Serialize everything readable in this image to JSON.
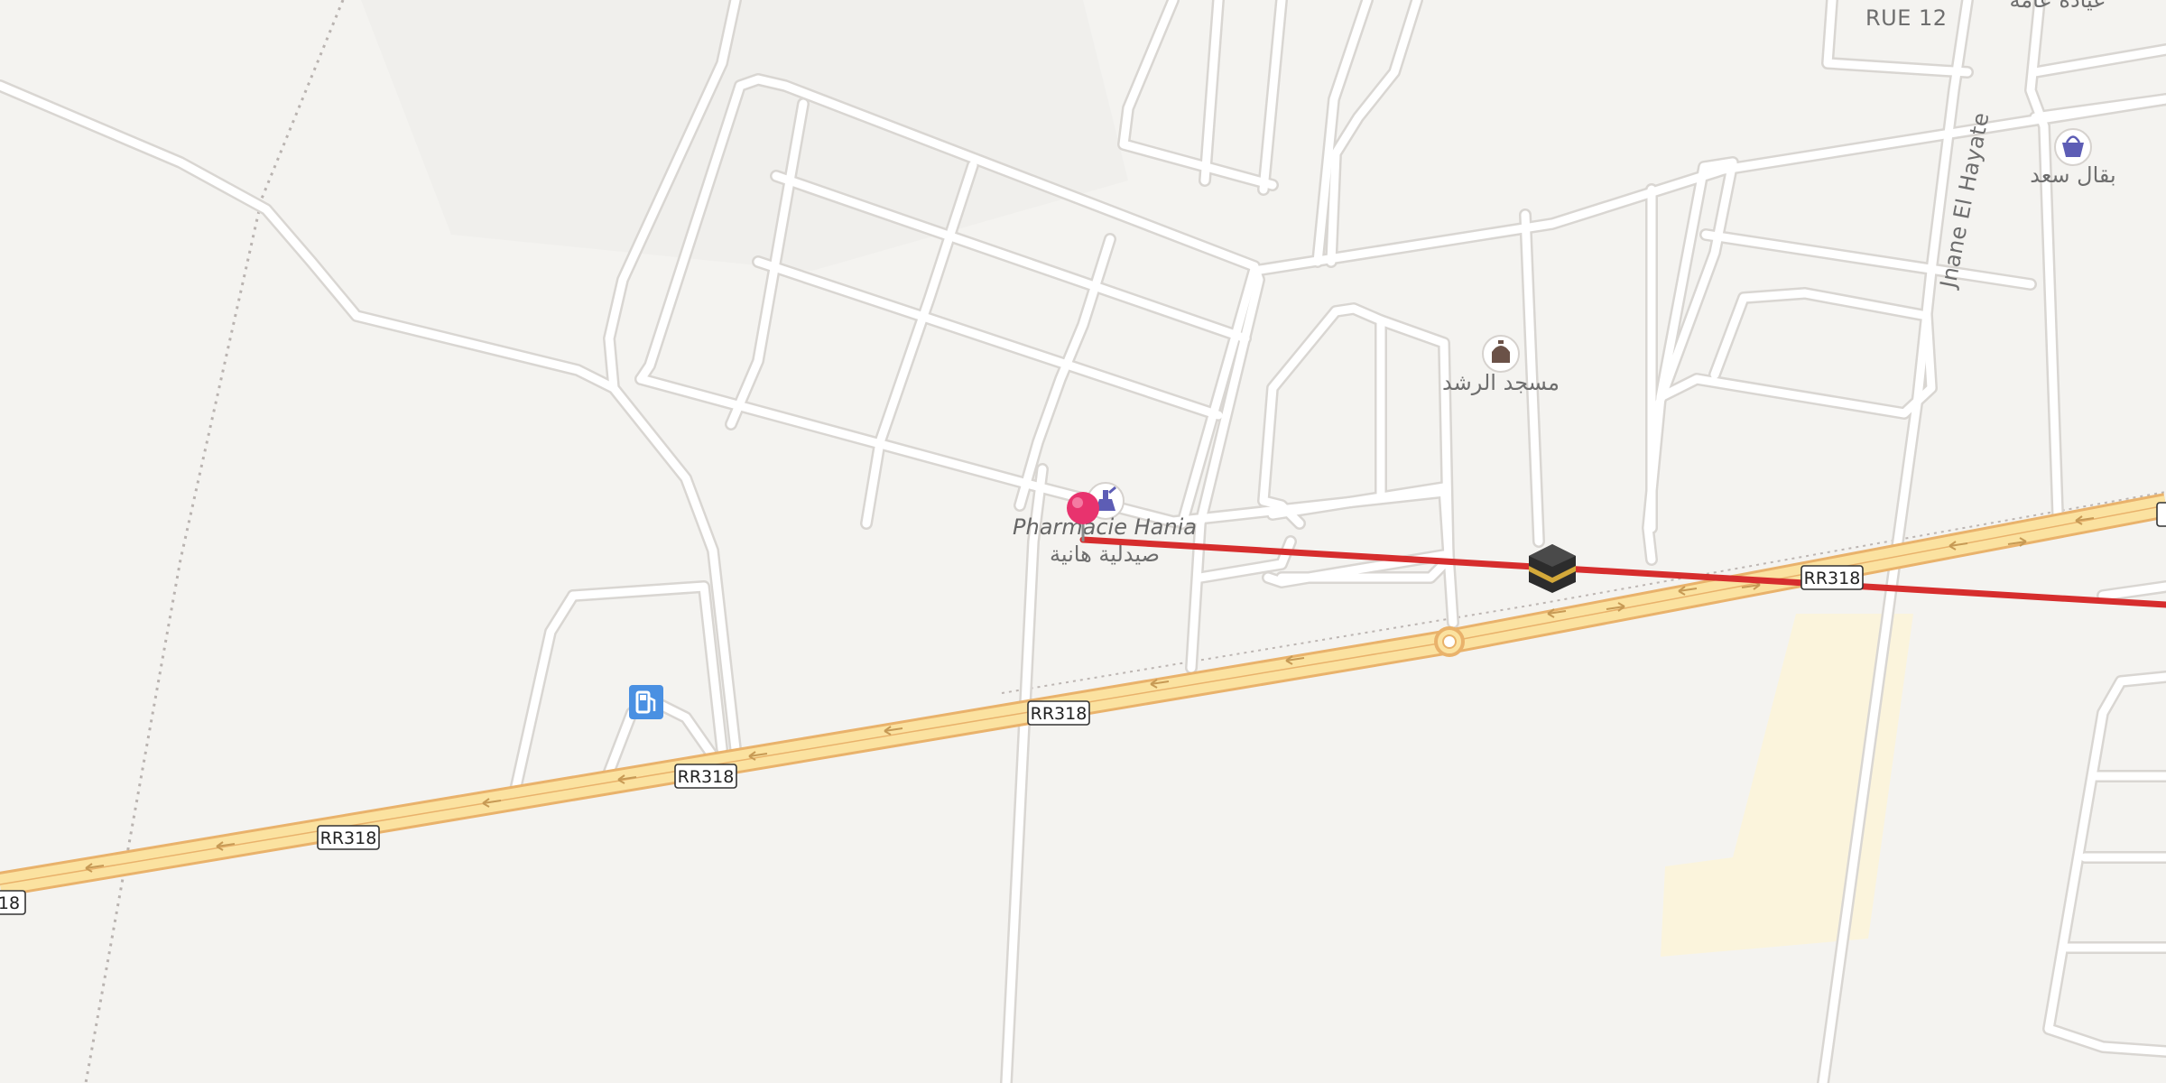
{
  "map": {
    "road_shields": [
      {
        "id": "rr318-a",
        "label": "RR318"
      },
      {
        "id": "rr318-b",
        "label": "RR318"
      },
      {
        "id": "rr318-c",
        "label": "RR318"
      },
      {
        "id": "rr318-d",
        "label": "RR318"
      },
      {
        "id": "rr318-e",
        "label": "18"
      }
    ],
    "streets": {
      "rue12": "RUE 12",
      "jnane": "Jnane El Hayate"
    },
    "pois": {
      "pharmacy_fr": "Pharmacie Hania",
      "pharmacy_ar": "صيدلية هانية",
      "mosque_ar": "مسجد الرشد",
      "grocery_ar": "بقال سعد",
      "top_right_ar": "عيادة عامة"
    },
    "route": {
      "color": "#d62d2d"
    },
    "colors": {
      "land": "#f4f3f0",
      "primary_road": "#fbe2a0",
      "primary_casing": "#e9b26b",
      "pin": "#e8336e",
      "poi_icon": "#5d5db5",
      "fuel": "#4a90e2",
      "sand": "#fbf4dc"
    },
    "icons": [
      "map-pin-icon",
      "pharmacy-icon",
      "mosque-icon",
      "shopping-basket-icon",
      "fuel-station-icon",
      "kaaba-icon"
    ]
  }
}
